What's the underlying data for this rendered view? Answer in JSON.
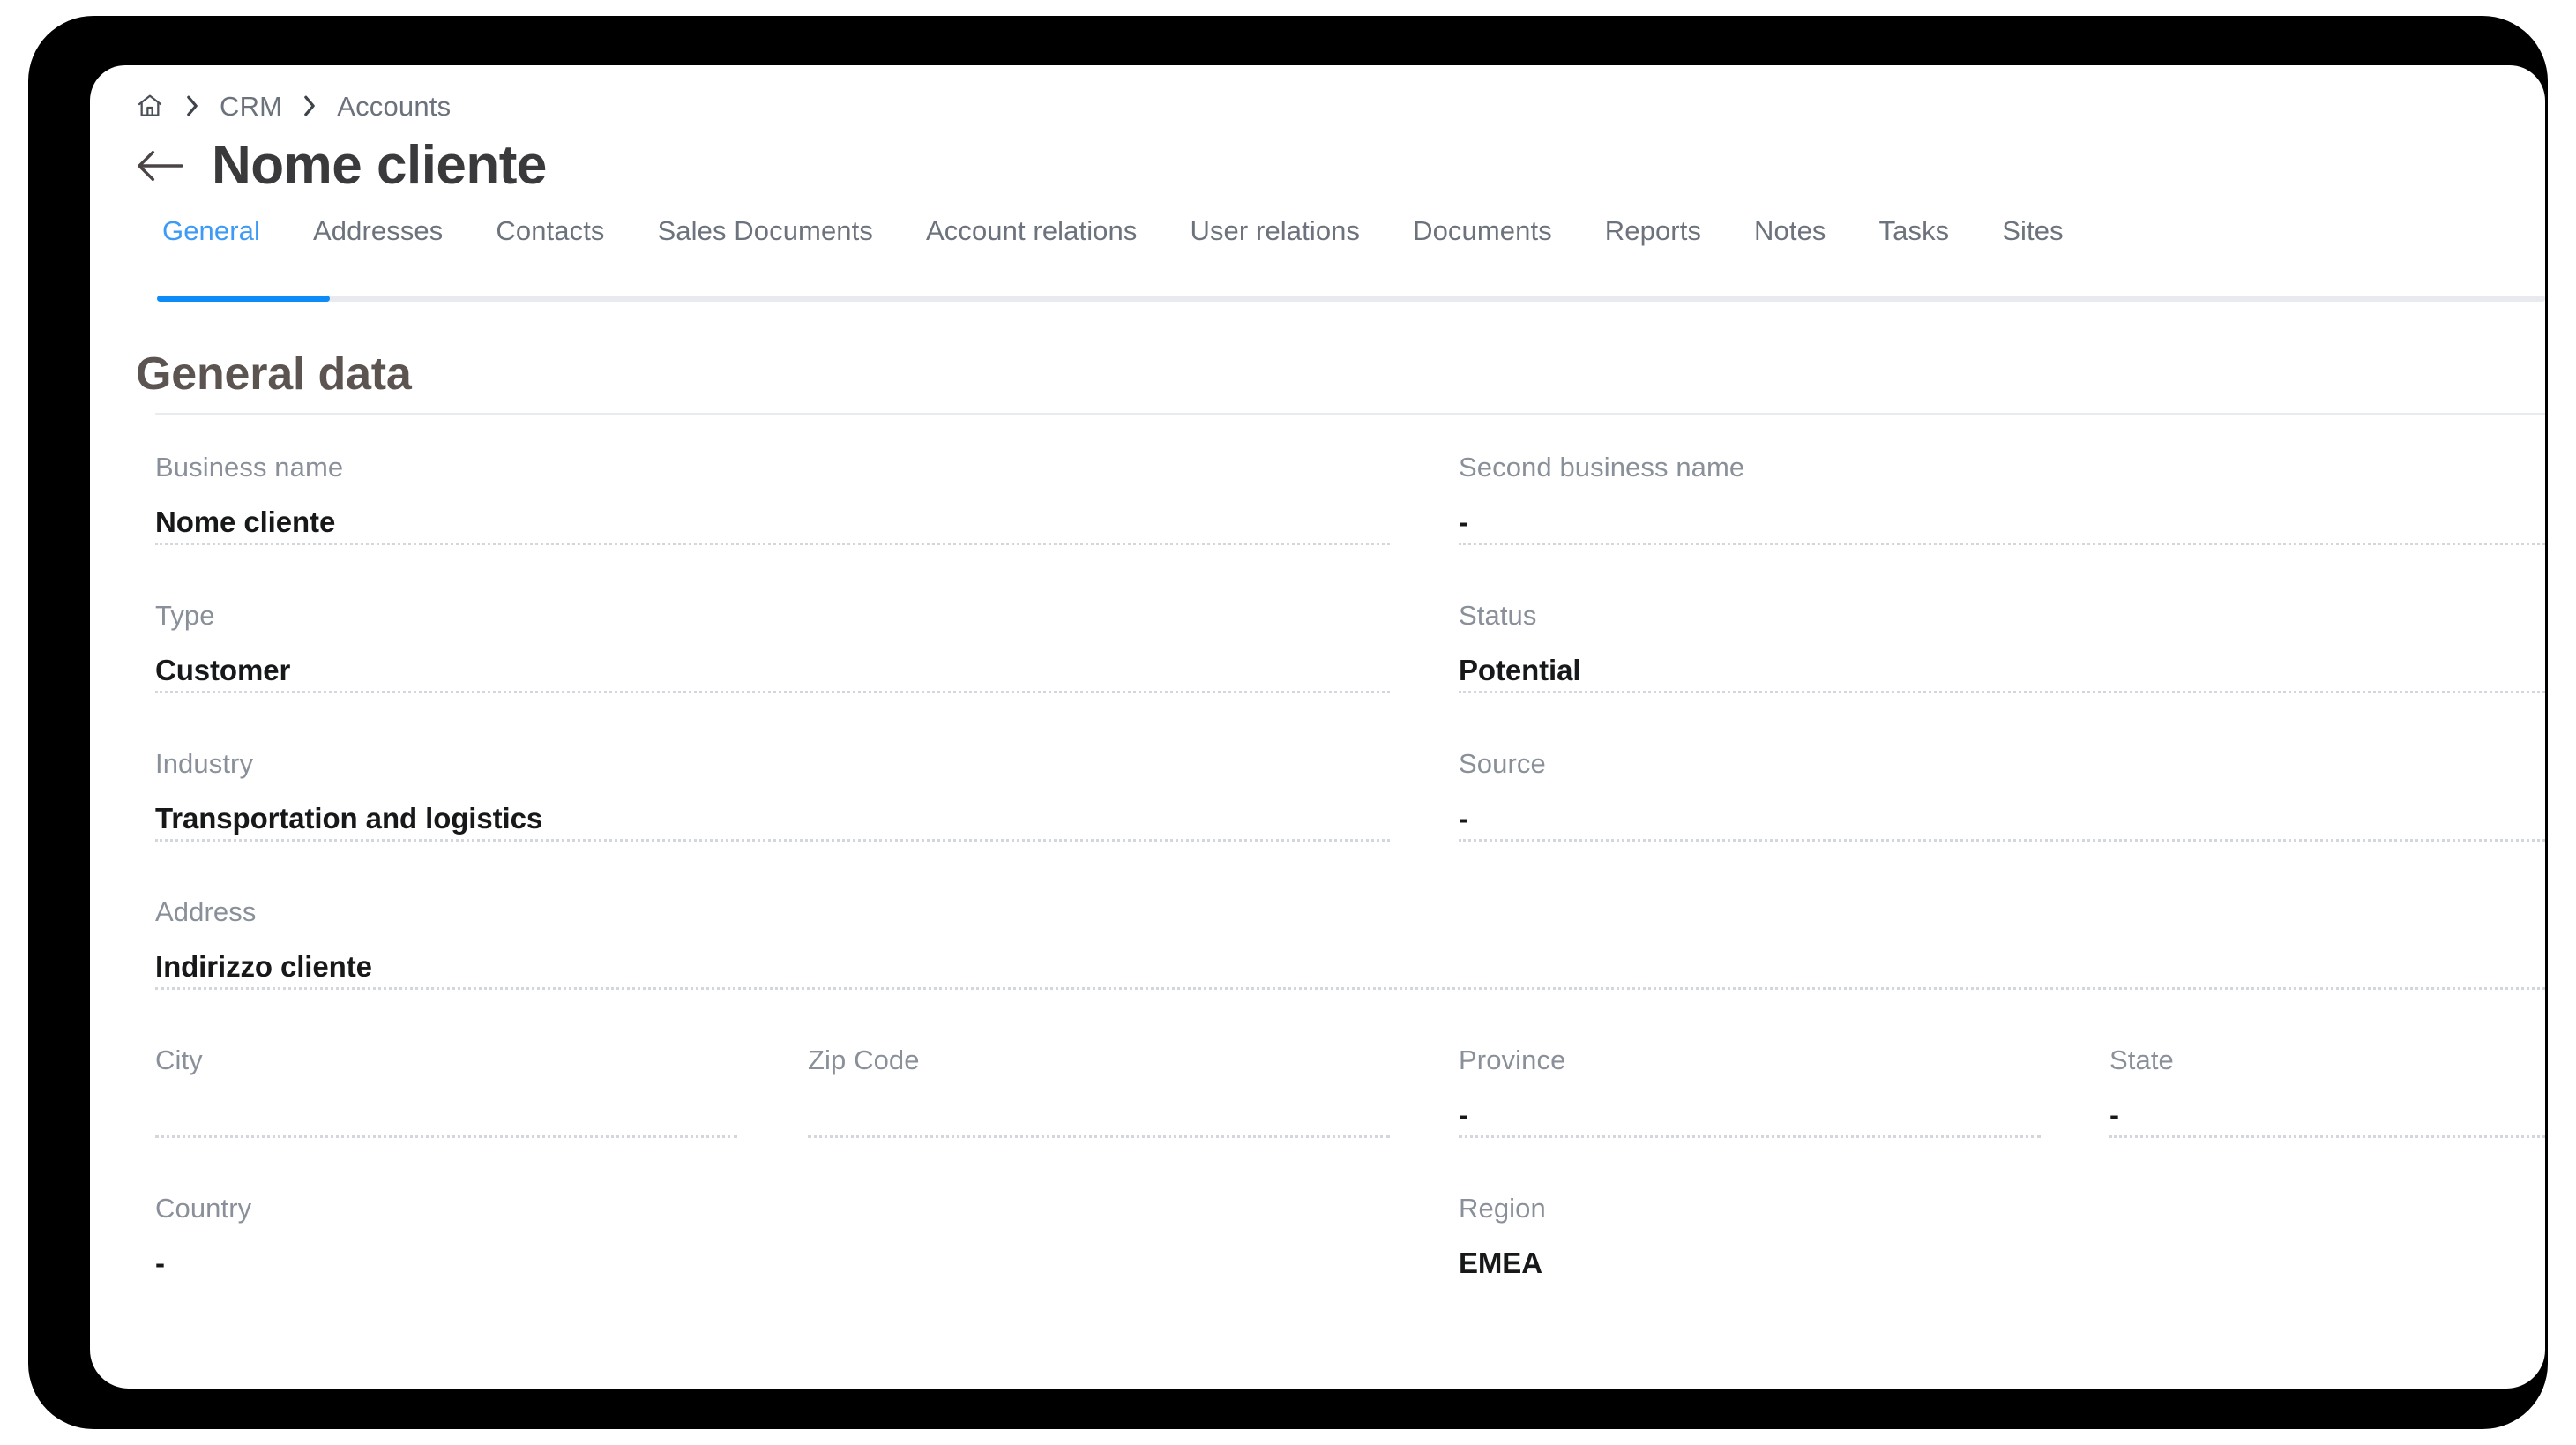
{
  "breadcrumb": {
    "home_icon": "home-icon",
    "separator_icon": "chevron-right-icon",
    "items": [
      {
        "label": "CRM"
      },
      {
        "label": "Accounts"
      }
    ]
  },
  "header": {
    "back_icon": "arrow-left-icon",
    "title": "Nome cliente"
  },
  "tabs": {
    "active_index": 0,
    "accent_color": "#0d8bf7",
    "items": [
      {
        "label": "General"
      },
      {
        "label": "Addresses"
      },
      {
        "label": "Contacts"
      },
      {
        "label": "Sales Documents"
      },
      {
        "label": "Account relations"
      },
      {
        "label": "User relations"
      },
      {
        "label": "Documents"
      },
      {
        "label": "Reports"
      },
      {
        "label": "Notes"
      },
      {
        "label": "Tasks"
      },
      {
        "label": "Sites"
      }
    ]
  },
  "section": {
    "title": "General data"
  },
  "fields": {
    "business_name": {
      "label": "Business name",
      "value": "Nome cliente"
    },
    "second_business_name": {
      "label": "Second business name",
      "value": "-"
    },
    "type": {
      "label": "Type",
      "value": "Customer"
    },
    "status": {
      "label": "Status",
      "value": "Potential"
    },
    "industry": {
      "label": "Industry",
      "value": "Transportation and logistics"
    },
    "source": {
      "label": "Source",
      "value": "-"
    },
    "address": {
      "label": "Address",
      "value": "Indirizzo cliente"
    },
    "city": {
      "label": "City",
      "value": ""
    },
    "zip_code": {
      "label": "Zip Code",
      "value": ""
    },
    "province": {
      "label": "Province",
      "value": "-"
    },
    "state": {
      "label": "State",
      "value": "-"
    },
    "country": {
      "label": "Country",
      "value": "-"
    },
    "region": {
      "label": "Region",
      "value": "EMEA"
    }
  }
}
